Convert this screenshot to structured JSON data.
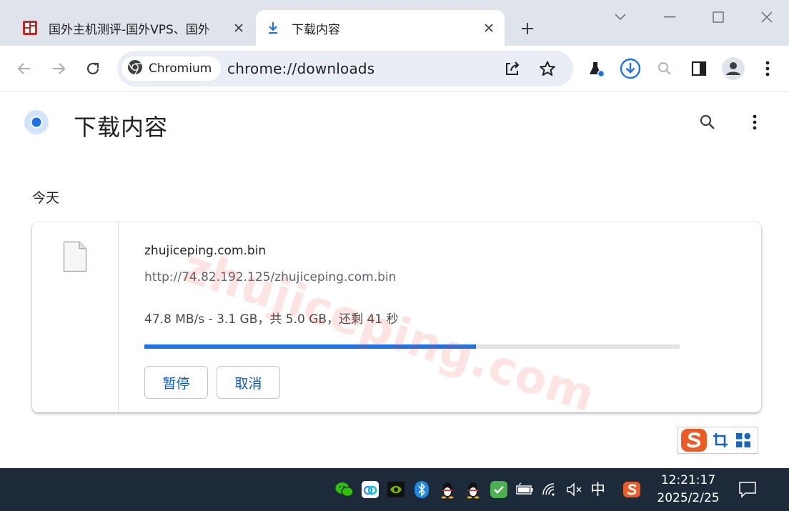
{
  "tabs": [
    {
      "title": "国外主机测评-国外VPS、国外",
      "active": false,
      "favicon": "site-seal-icon",
      "close_icon": "close-icon"
    },
    {
      "title": "下载内容",
      "active": true,
      "favicon": "download-icon",
      "close_icon": "close-icon"
    }
  ],
  "new_tab_icon": "plus-icon",
  "window_controls": [
    "tab-search-icon",
    "minimize-icon",
    "maximize-icon",
    "close-window-icon"
  ],
  "toolbar": {
    "back_icon": "back-arrow-icon",
    "forward_icon": "forward-arrow-icon",
    "reload_icon": "reload-icon",
    "chip_label": "Chromium",
    "url": "chrome://downloads",
    "share_icon": "share-icon",
    "bookmark_icon": "star-icon",
    "labs_icon": "flask-icon",
    "downloads_icon": "download-circle-icon",
    "zoom_icon": "zoom-icon",
    "side_panel_icon": "side-panel-icon",
    "profile_icon": "avatar-icon",
    "menu_icon": "kebab-menu-icon"
  },
  "page": {
    "title": "下载内容",
    "search_icon": "search-icon",
    "menu_icon": "kebab-menu-icon",
    "section_label": "今天"
  },
  "download": {
    "file_name": "zhujiceping.com.bin",
    "url": "http://74.82.192.125/zhujiceping.com.bin",
    "status": "47.8 MB/s - 3.1 GB，共 5.0 GB，还剩 41 秒",
    "progress_fraction": 0.62,
    "pause_label": "暂停",
    "cancel_label": "取消",
    "file_icon": "file-icon"
  },
  "watermark": "zhujiceping.com",
  "ime_toolbar": [
    "sogou-s-icon",
    "crop-icon",
    "grid-icon"
  ],
  "taskbar": {
    "tray_icons": [
      "wechat-icon",
      "baidu-netdisk-icon",
      "nvidia-icon",
      "bluetooth-icon",
      "qq-icon",
      "qq-icon",
      "shield-check-icon",
      "battery-icon",
      "wifi-icon",
      "volume-muted-icon"
    ],
    "ime_mode": "中",
    "sogou_icon": "sogou-s-icon",
    "time": "12:21:17",
    "date": "2025/2/25",
    "notification_icon": "notification-icon"
  },
  "colors": {
    "accent": "#1a73e8",
    "button_text": "#0b57d0",
    "tabstrip": "#dfe3eb",
    "omnibox": "#e9eef6",
    "taskbar": "#1d2a3a"
  }
}
